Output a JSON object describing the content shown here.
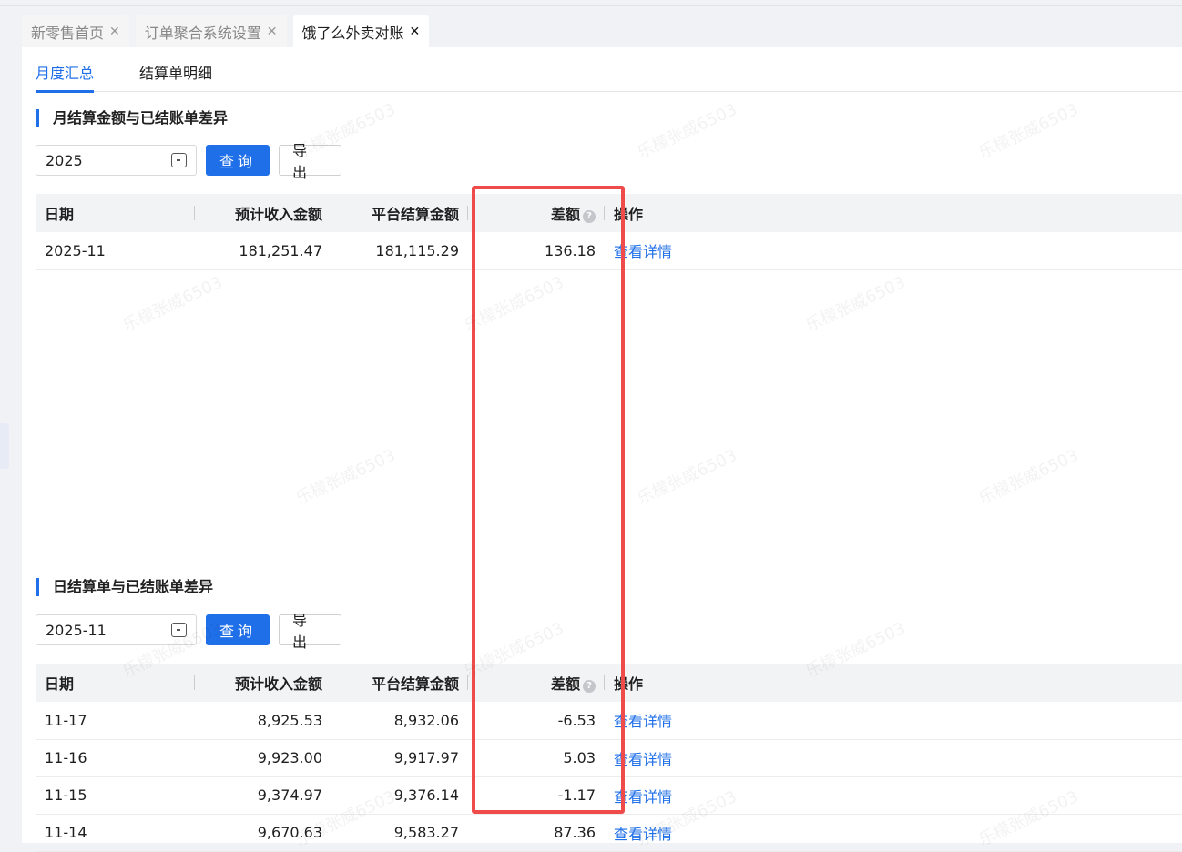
{
  "tabs": [
    {
      "label": "新零售首页",
      "close": "✕"
    },
    {
      "label": "订单聚合系统设置",
      "close": "✕"
    },
    {
      "label": "饿了么外卖对账",
      "close": "✕"
    }
  ],
  "subtabs": [
    "月度汇总",
    "结算单明细"
  ],
  "watermark": "乐檬张威6503",
  "monthly": {
    "title": "月结算金额与已结账单差异",
    "picker_value": "2025",
    "query": "查询",
    "export": "导出",
    "headers": [
      "日期",
      "预计收入金额",
      "平台结算金额",
      "差额",
      "操作"
    ],
    "rows": [
      {
        "date": "2025-11",
        "expected": "181,251.47",
        "platform": "181,115.29",
        "diff": "136.18",
        "action": "查看详情"
      }
    ]
  },
  "daily": {
    "title": "日结算单与已结账单差异",
    "picker_value": "2025-11",
    "query": "查询",
    "export": "导出",
    "headers": [
      "日期",
      "预计收入金额",
      "平台结算金额",
      "差额",
      "操作"
    ],
    "rows": [
      {
        "date": "11-17",
        "expected": "8,925.53",
        "platform": "8,932.06",
        "diff": "-6.53",
        "action": "查看详情"
      },
      {
        "date": "11-16",
        "expected": "9,923.00",
        "platform": "9,917.97",
        "diff": "5.03",
        "action": "查看详情"
      },
      {
        "date": "11-15",
        "expected": "9,374.97",
        "platform": "9,376.14",
        "diff": "-1.17",
        "action": "查看详情"
      },
      {
        "date": "11-14",
        "expected": "9,670.63",
        "platform": "9,583.27",
        "diff": "87.36",
        "action": "查看详情"
      }
    ]
  }
}
